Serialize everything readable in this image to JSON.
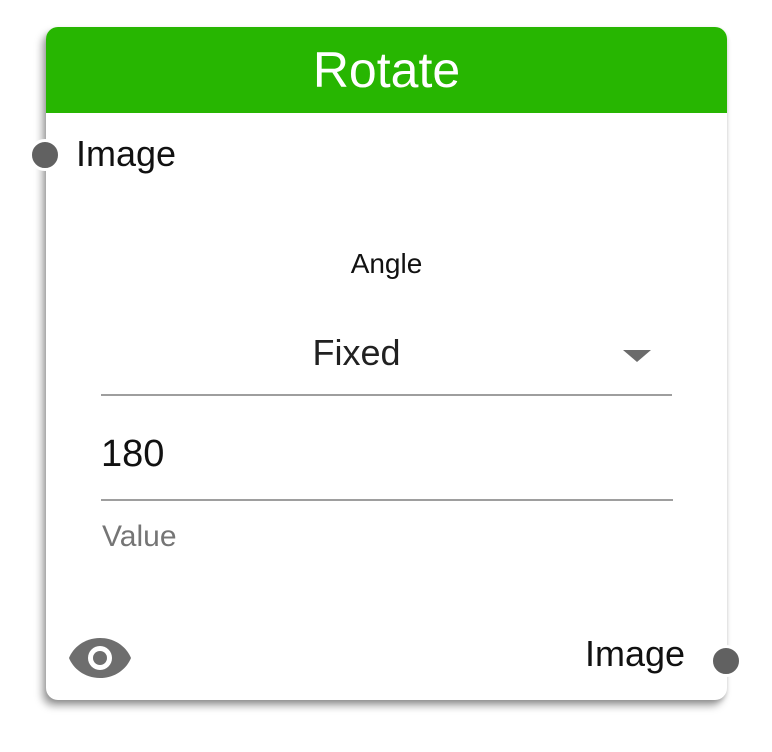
{
  "node": {
    "title": "Rotate",
    "header_color": "#27b601",
    "input_port": {
      "label": "Image"
    },
    "output_port": {
      "label": "Image"
    }
  },
  "angle": {
    "title": "Angle",
    "mode": {
      "selected": "Fixed"
    },
    "value": {
      "current": "180",
      "label": "Value"
    }
  },
  "icons": {
    "preview": "eye-icon",
    "dropdown": "triangle-down-icon"
  }
}
